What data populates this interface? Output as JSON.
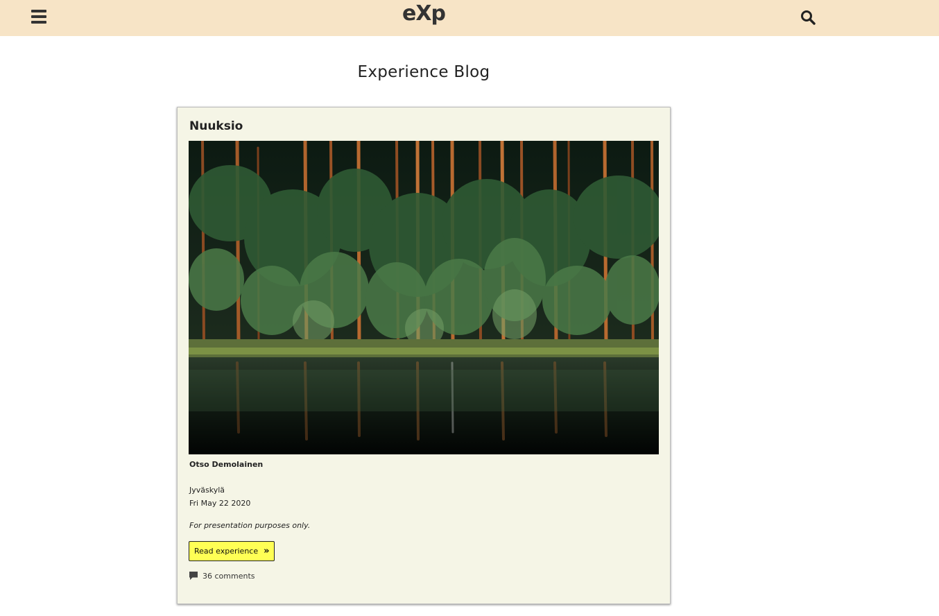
{
  "header": {
    "logo": "eXp",
    "menu_icon": "hamburger-menu-icon",
    "search_icon": "search-icon",
    "background": "#f7e4c6"
  },
  "page": {
    "title": "Experience Blog"
  },
  "post": {
    "title": "Nuuksio",
    "image_icon": "forest-lake-photo",
    "author": "Otso Demolainen",
    "location": "Jyväskylä",
    "date": "Fri May 22 2020",
    "note": "For presentation purposes only.",
    "read_label": "Read experience",
    "read_icon": "double-chevron-right-icon",
    "comments_icon": "comment-icon",
    "comments_label": "36 comments",
    "button_color": "#ffff55",
    "card_background": "#f5f5e6"
  }
}
